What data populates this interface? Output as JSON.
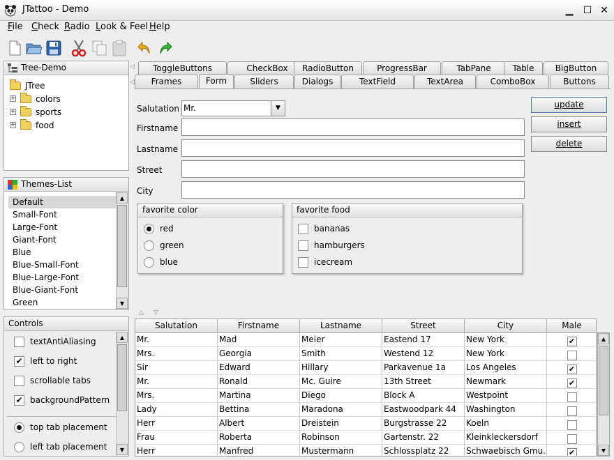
{
  "window": {
    "title": "JTattoo - Demo",
    "minimize": "▁",
    "maximize": "☐",
    "close": "✕"
  },
  "menu": [
    {
      "first": "F",
      "rest": "ile"
    },
    {
      "first": "C",
      "rest": "heck"
    },
    {
      "first": "R",
      "rest": "adio"
    },
    {
      "first": "L",
      "rest": "ook & Feel"
    },
    {
      "first": "H",
      "rest": "elp"
    }
  ],
  "toolbar": [
    "new-file-icon",
    "open-folder-icon",
    "save-icon",
    "cut-icon",
    "copy-icon",
    "paste-icon",
    "undo-icon",
    "redo-icon"
  ],
  "tree": {
    "title": "Tree-Demo",
    "root": "JTree",
    "children": [
      "colors",
      "sports",
      "food"
    ],
    "expander": "+"
  },
  "themes": {
    "title": "Themes-List",
    "items": [
      "Default",
      "Small-Font",
      "Large-Font",
      "Giant-Font",
      "Blue",
      "Blue-Small-Font",
      "Blue-Large-Font",
      "Blue-Giant-Font",
      "Green"
    ],
    "selected_index": 0
  },
  "controls": {
    "title": "Controls",
    "checkboxes": [
      {
        "label": "textAntiAliasing",
        "checked": false
      },
      {
        "label": "left to right",
        "checked": true
      },
      {
        "label": "scrollable tabs",
        "checked": false
      },
      {
        "label": "backgroundPattern",
        "checked": true
      }
    ],
    "radios": [
      {
        "label": "top tab placement",
        "selected": true
      },
      {
        "label": "left tab placement",
        "selected": false
      }
    ]
  },
  "tabs": {
    "row1": [
      "ToggleButtons",
      "CheckBox",
      "RadioButton",
      "ProgressBar",
      "TabPane",
      "Table",
      "BigButton"
    ],
    "row2": [
      "Frames",
      "Form",
      "Sliders",
      "Dialogs",
      "TextField",
      "TextArea",
      "ComboBox",
      "Buttons"
    ],
    "active": "Form"
  },
  "form": {
    "salutation_label": "Salutation",
    "salutation_value": "Mr.",
    "firstname_label": "Firstname",
    "lastname_label": "Lastname",
    "street_label": "Street",
    "city_label": "City",
    "firstname": "",
    "lastname": "",
    "street": "",
    "city": "",
    "buttons": {
      "update": "update",
      "insert": "insert",
      "delete": "delete"
    },
    "color_group": {
      "title": "favorite color",
      "options": [
        "red",
        "green",
        "blue"
      ],
      "selected": "red"
    },
    "food_group": {
      "title": "favorite food",
      "options": [
        {
          "label": "bananas",
          "checked": false
        },
        {
          "label": "hamburgers",
          "checked": false
        },
        {
          "label": "icecream",
          "checked": false
        }
      ]
    }
  },
  "table": {
    "columns": [
      "Salutation",
      "Firstname",
      "Lastname",
      "Street",
      "City",
      "Male"
    ],
    "rows": [
      [
        "Mr.",
        "Mad",
        "Meier",
        "Eastend 17",
        "New York",
        true
      ],
      [
        "Mrs.",
        "Georgia",
        "Smith",
        "Westend 12",
        "New York",
        false
      ],
      [
        "Sir",
        "Edward",
        "Hillary",
        "Parkavenue 1a",
        "Los Angeles",
        true
      ],
      [
        "Mr.",
        "Ronald",
        "Mc. Guire",
        "13th Street",
        "Newmark",
        true
      ],
      [
        "Mrs.",
        "Martina",
        "Diego",
        "Block A",
        "Westpoint",
        false
      ],
      [
        "Lady",
        "Bettina",
        "Maradona",
        "Eastwoodpark 44",
        "Washington",
        false
      ],
      [
        "Herr",
        "Albert",
        "Dreistein",
        "Burgstrasse 22",
        "Koeln",
        false
      ],
      [
        "Frau",
        "Roberta",
        "Robinson",
        "Gartenstr. 22",
        "Kleinkleckersdorf",
        false
      ],
      [
        "Herr",
        "Manfred",
        "Mustermann",
        "Schlossplatz 22",
        "Schwaebisch Gmu...",
        true
      ]
    ]
  },
  "glyphs": {
    "check": "✔",
    "down": "▼",
    "up": "▲",
    "left": "◁",
    "up_small": "△",
    "down_small": "▽"
  }
}
